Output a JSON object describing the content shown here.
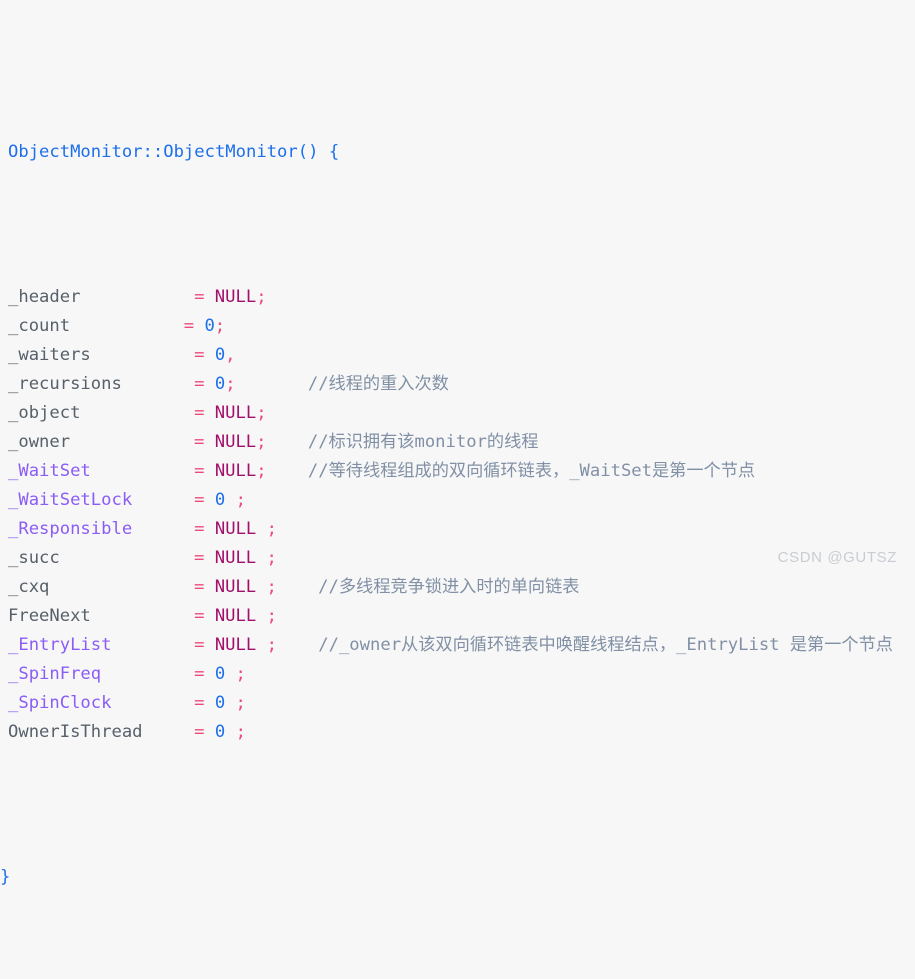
{
  "editor": {
    "language": "cpp",
    "background_color": "#f7f7f7",
    "colors": {
      "function": "#1d6fec",
      "identifier": "#57606a",
      "special_identifier": "#8b5cf6",
      "operator": "#ec4a7b",
      "constant_null": "#a3106c",
      "number": "#1d6fec",
      "comment": "#8190a5",
      "watermark": "#c9cdd2"
    }
  },
  "code": {
    "signature": {
      "name": "ObjectMonitor::ObjectMonitor",
      "parens": "()",
      "open_brace": "{"
    },
    "close_brace": "}",
    "assign": "=",
    "semicolon": ";",
    "comma": ",",
    "lines": [
      {
        "field": "_header",
        "field_style": "ident",
        "value": "NULL",
        "value_style": "null",
        "terminator": ";",
        "terminator_spaced": false,
        "eq_col": 18,
        "comment": ""
      },
      {
        "field": "_count",
        "field_style": "ident",
        "value": "0",
        "value_style": "num",
        "terminator": ";",
        "terminator_spaced": false,
        "eq_col": 17,
        "comment": ""
      },
      {
        "field": "_waiters",
        "field_style": "ident",
        "value": "0",
        "value_style": "num",
        "terminator": ",",
        "terminator_spaced": false,
        "eq_col": 18,
        "comment": ""
      },
      {
        "field": "_recursions",
        "field_style": "ident",
        "value": "0",
        "value_style": "num",
        "terminator": ";",
        "terminator_spaced": false,
        "eq_col": 18,
        "comment": "//线程的重入次数",
        "comment_col": 29
      },
      {
        "field": "_object",
        "field_style": "ident",
        "value": "NULL",
        "value_style": "null",
        "terminator": ";",
        "terminator_spaced": false,
        "eq_col": 18,
        "comment": ""
      },
      {
        "field": "_owner",
        "field_style": "ident",
        "value": "NULL",
        "value_style": "null",
        "terminator": ";",
        "terminator_spaced": false,
        "eq_col": 18,
        "comment": "//标识拥有该monitor的线程",
        "comment_col": 29
      },
      {
        "field": "_WaitSet",
        "field_style": "special",
        "value": "NULL",
        "value_style": "null",
        "terminator": ";",
        "terminator_spaced": false,
        "eq_col": 18,
        "comment": "//等待线程组成的双向循环链表，_WaitSet是第一个节点",
        "comment_col": 29
      },
      {
        "field": "_WaitSetLock",
        "field_style": "special",
        "value": "0",
        "value_style": "num",
        "terminator": ";",
        "terminator_spaced": true,
        "eq_col": 18,
        "comment": ""
      },
      {
        "field": "_Responsible",
        "field_style": "special",
        "value": "NULL",
        "value_style": "null",
        "terminator": ";",
        "terminator_spaced": true,
        "eq_col": 18,
        "comment": ""
      },
      {
        "field": "_succ",
        "field_style": "ident",
        "value": "NULL",
        "value_style": "null",
        "terminator": ";",
        "terminator_spaced": true,
        "eq_col": 18,
        "comment": ""
      },
      {
        "field": "_cxq",
        "field_style": "ident",
        "value": "NULL",
        "value_style": "null",
        "terminator": ";",
        "terminator_spaced": true,
        "eq_col": 18,
        "comment": "//多线程竞争锁进入时的单向链表",
        "comment_col": 30
      },
      {
        "field": "FreeNext",
        "field_style": "ident",
        "value": "NULL",
        "value_style": "null",
        "terminator": ";",
        "terminator_spaced": true,
        "eq_col": 18,
        "comment": ""
      },
      {
        "field": "_EntryList",
        "field_style": "special",
        "value": "NULL",
        "value_style": "null",
        "terminator": ";",
        "terminator_spaced": true,
        "eq_col": 18,
        "comment": "//_owner从该双向循环链表中唤醒线程结点，_EntryList 是第一个节点",
        "comment_col": 30
      },
      {
        "field": "_SpinFreq",
        "field_style": "special",
        "value": "0",
        "value_style": "num",
        "terminator": ";",
        "terminator_spaced": true,
        "eq_col": 18,
        "comment": ""
      },
      {
        "field": "_SpinClock",
        "field_style": "special",
        "value": "0",
        "value_style": "num",
        "terminator": ";",
        "terminator_spaced": true,
        "eq_col": 18,
        "comment": ""
      },
      {
        "field": "OwnerIsThread",
        "field_style": "ident",
        "value": "0",
        "value_style": "num",
        "terminator": ";",
        "terminator_spaced": true,
        "eq_col": 18,
        "comment": ""
      }
    ]
  },
  "watermark": {
    "text": "CSDN @GUTSZ"
  }
}
